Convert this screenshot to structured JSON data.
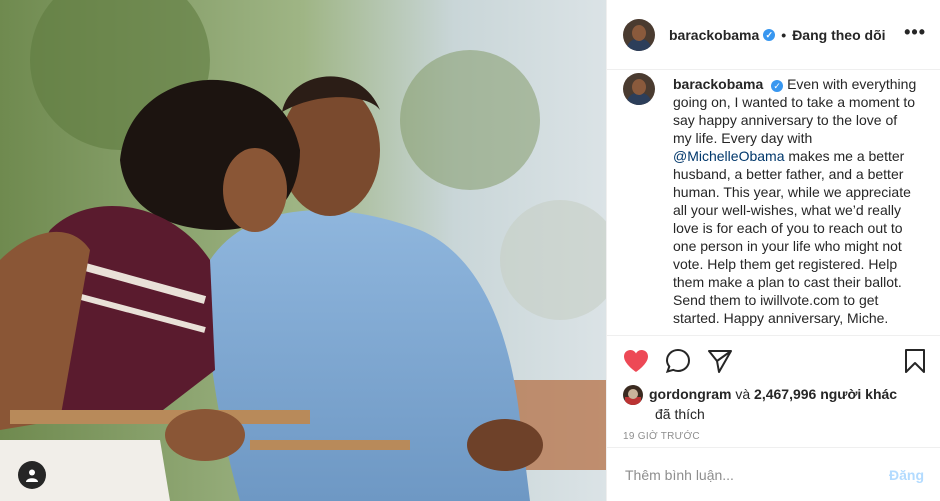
{
  "post": {
    "username": "barackobama",
    "follow_separator": "•",
    "follow_status": "Đang theo dõi",
    "more_icon": "more-horizontal-icon",
    "caption": {
      "username": "barackobama",
      "text_before_mention": "Even with everything going on, I wanted to take a moment to say happy anniversary to the love of my life. Every day with",
      "mention": "@MichelleObama",
      "text_after_mention": "makes me a better husband, a better father, and a better human. This year, while we appreciate all your well-wishes, what we’d really love is for each of you to reach out to one person in your life who might not vote. Help them get registered. Help them make a plan to cast their ballot. Send them to iwillvote.com to get started. Happy anniversary, Miche."
    },
    "likes": {
      "liker": "gordongram",
      "connector": "và",
      "others": "2,467,996 người khác",
      "suffix": "đã thích"
    },
    "timestamp": "19 GIỜ TRƯỚC",
    "comment_placeholder": "Thêm bình luận...",
    "post_button": "Đăng",
    "liked": true
  },
  "colors": {
    "like_red": "#ed4956",
    "verified_blue": "#3897f0",
    "mention_blue": "#00376b",
    "post_disabled": "#b3dbff"
  }
}
